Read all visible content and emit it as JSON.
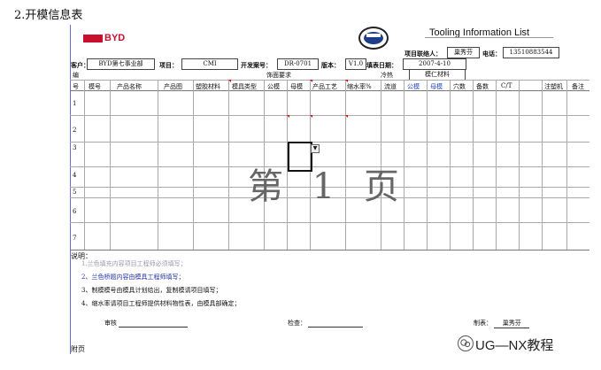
{
  "heading": "2.开模信息表",
  "brand_logo": "BYD",
  "form_title": "Tooling Information List",
  "meta": {
    "contact_label": "项目联络人：",
    "contact_value": "巢秀芬",
    "phone_label": "电话：",
    "phone_value": "13510883544",
    "customer_label": "客户：",
    "customer_value": "BYD第七事业部",
    "project_label": "项目：",
    "project_value": "CMI",
    "case_label": "开发案号：",
    "case_value": "DR-0701",
    "version_label": "版本：",
    "version_value": "V1.0",
    "date_label": "填表日期：",
    "date_value": "2007-4-10"
  },
  "group_headers": {
    "no": "编",
    "no2": "号",
    "finish": "饰面要求",
    "hot": "冷热",
    "insert": "模仁材料"
  },
  "columns": [
    "模号",
    "产品名称",
    "产品图",
    "塑胶材料",
    "模具类型",
    "公模",
    "母模",
    "产品工艺",
    "缩水率%",
    "流道",
    "公模",
    "母模",
    "穴数",
    "备数",
    "C/T",
    "注塑机",
    "备注"
  ],
  "rows": [
    "1",
    "2",
    "3",
    "4",
    "5",
    "6",
    "7"
  ],
  "watermark": "第 1 页",
  "dropdown_arrow": "▼",
  "notes": {
    "title": "说明：",
    "items": [
      "1.兰色填充内容项目工程师必须填写；",
      "2、兰色桥题内容由模具工程师填写；",
      "3、制模模号由模具计划给出，复制模请项目填写；",
      "4、缩水率请项目工程师提供材料物性表，由模具部确定；"
    ]
  },
  "signatures": {
    "review": "审核",
    "check": "检查：",
    "prepared": "制表：",
    "prepared_by": "巢秀芬"
  },
  "page_footer": "附页",
  "channel_brand": "UG—NX教程",
  "wechat_icon": "wechat-icon"
}
